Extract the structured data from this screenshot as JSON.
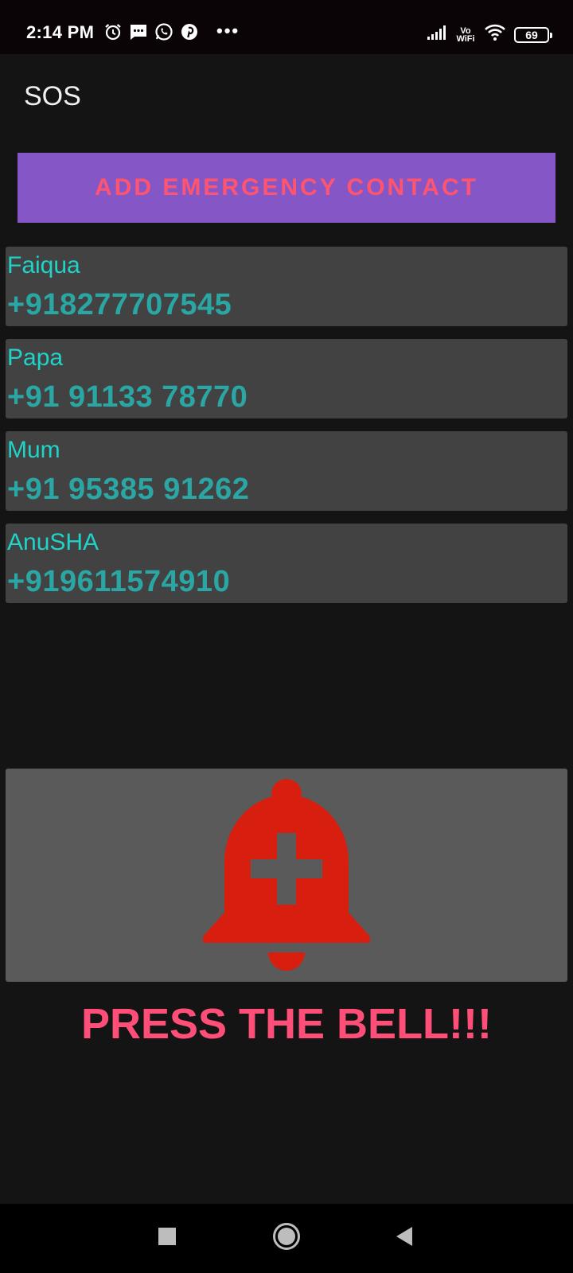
{
  "status_bar": {
    "time": "2:14 PM",
    "icons_left": [
      "alarm-icon",
      "message-icon",
      "whatsapp-icon",
      "pinterest-icon"
    ],
    "more": "•••",
    "vowifi_line1": "Vo",
    "vowifi_line2": "WiFi",
    "battery": "69"
  },
  "app_bar": {
    "title": "SOS"
  },
  "add_button": {
    "label": "ADD EMERGENCY CONTACT"
  },
  "contacts": [
    {
      "name": "Faiqua",
      "phone": "+918277707545"
    },
    {
      "name": "Papa",
      "phone": "+91 91133 78770"
    },
    {
      "name": "Mum",
      "phone": "+91 95385 91262"
    },
    {
      "name": "AnuSHA",
      "phone": "+919611574910"
    }
  ],
  "bell": {
    "icon": "sos-bell-icon",
    "color": "#d81e0e"
  },
  "prompt": {
    "text": "PRESS THE BELL!!!"
  },
  "colors": {
    "accent_button": "#8557c6",
    "button_text": "#ff5470",
    "contact_name": "#1fd3c8",
    "contact_phone": "#2aa7a4",
    "prompt_text": "#ff4f78"
  },
  "nav_bar": {
    "icons": [
      "recent-apps-icon",
      "home-icon",
      "back-icon"
    ]
  }
}
